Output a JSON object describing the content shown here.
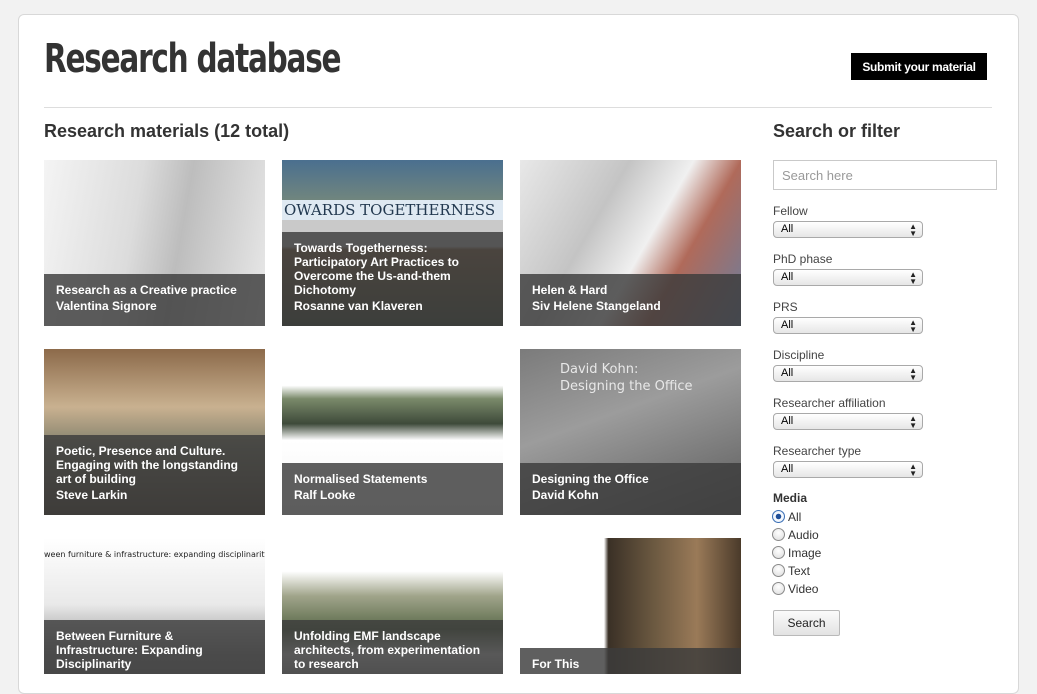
{
  "header": {
    "title": "Research database",
    "submit_label": "Submit your material"
  },
  "materials": {
    "heading": "Research materials (12 total)",
    "cards": [
      {
        "title": "Research as a Creative practice",
        "author": "Valentina Signore"
      },
      {
        "title": "Towards Togetherness: Participatory Art Practices to Overcome the Us-and-them Dichotomy",
        "author": "Rosanne van Klaveren",
        "art_banner": "OWARDS TOGETHERNESS"
      },
      {
        "title": "Helen & Hard",
        "author": "Siv Helene Stangeland"
      },
      {
        "title": "Poetic, Presence and Culture. Engaging with the longstanding art of building",
        "author": "Steve Larkin"
      },
      {
        "title": "Normalised Statements",
        "author": "Ralf Looke"
      },
      {
        "title": "Designing the Office",
        "author": "David Kohn",
        "art_text": "David Kohn:\nDesigning the Office"
      },
      {
        "title": "Between Furniture & Infrastructure: Expanding Disciplinarity",
        "author": "",
        "art_strip": "ween furniture & infrastructure: expanding disciplinarity"
      },
      {
        "title": "Unfolding EMF landscape architects, from experimentation to research",
        "author": ""
      },
      {
        "title": "For This",
        "author": ""
      }
    ]
  },
  "sidebar": {
    "heading": "Search or filter",
    "search_placeholder": "Search here",
    "filters": [
      {
        "label": "Fellow",
        "value": "All"
      },
      {
        "label": "PhD phase",
        "value": "All"
      },
      {
        "label": "PRS",
        "value": "All"
      },
      {
        "label": "Discipline",
        "value": "All"
      },
      {
        "label": "Researcher affiliation",
        "value": "All"
      },
      {
        "label": "Researcher type",
        "value": "All"
      }
    ],
    "media": {
      "label": "Media",
      "options": [
        "All",
        "Audio",
        "Image",
        "Text",
        "Video"
      ],
      "selected": "All"
    },
    "search_button": "Search"
  },
  "icons": {
    "select_caret": "up-down-caret-icon",
    "radio": "radio-button-icon"
  },
  "colors": {
    "accent_button": "#000000",
    "caption_overlay": "#3c3c3c",
    "radio_checked": "#1f4f99"
  }
}
